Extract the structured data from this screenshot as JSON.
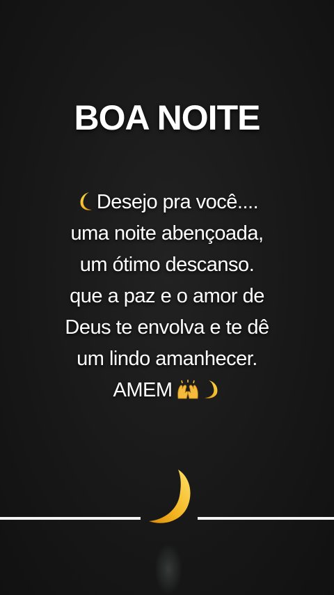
{
  "title": "BOA NOITE",
  "message": {
    "line1": "Desejo pra você....",
    "line2": "uma noite abençoada,",
    "line3": "um ótimo descanso.",
    "line4": "que a paz e o amor de",
    "line5": "Deus te envolva e te dê",
    "line6": "um lindo amanhecer.",
    "line7": "AMEM"
  },
  "icons": {
    "line1_lead": "crescent-moon-icon",
    "line7_trail": [
      "raising-hands-icon",
      "crescent-moon-icon"
    ],
    "center": "crescent-moon-icon"
  },
  "colors": {
    "background": "#141414",
    "text": "#ffffff",
    "moon": "#f2b21c",
    "divider": "#f4f4f4"
  }
}
